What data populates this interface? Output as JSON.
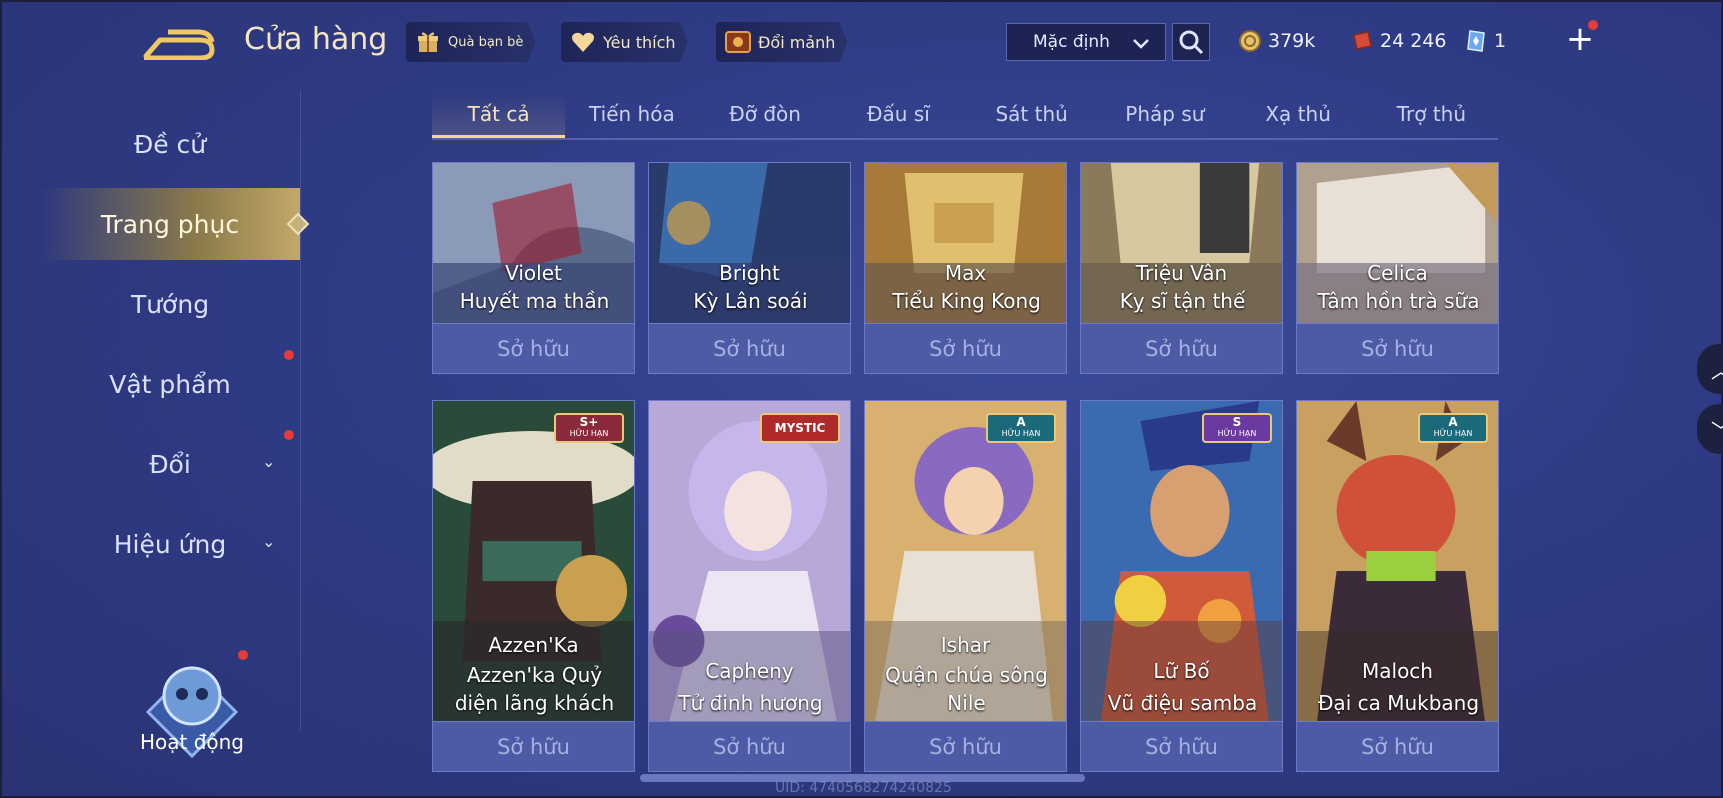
{
  "header": {
    "title": "Cửa hàng",
    "buttons": [
      {
        "label": "Quà bạn bè",
        "icon": "gift-icon"
      },
      {
        "label": "Yêu thích",
        "icon": "heart-icon"
      },
      {
        "label": "Đổi mảnh",
        "icon": "shard-chest-icon"
      }
    ],
    "sort_value": "Mặc định",
    "currencies": [
      {
        "value": "379k",
        "icon": "gold-coin-icon"
      },
      {
        "value": "24 246",
        "icon": "red-voucher-icon"
      },
      {
        "value": "1",
        "icon": "diamond-card-icon"
      }
    ]
  },
  "nav": {
    "items": [
      {
        "label": "Đề cử",
        "active": false
      },
      {
        "label": "Trang phục",
        "active": true
      },
      {
        "label": "Tướng",
        "active": false
      },
      {
        "label": "Vật phẩm",
        "active": false
      },
      {
        "label": "Đổi",
        "active": false
      },
      {
        "label": "Hiệu ứng",
        "active": false
      }
    ],
    "activity_label": "Hoạt động"
  },
  "tabs": [
    "Tất cả",
    "Tiến hóa",
    "Đỡ đòn",
    "Đấu sĩ",
    "Sát thủ",
    "Pháp sư",
    "Xạ thủ",
    "Trợ thủ"
  ],
  "cards_row1": [
    {
      "hero": "Violet",
      "skin": "Huyết ma thần",
      "status": "Sở hữu"
    },
    {
      "hero": "Bright",
      "skin": "Kỳ Lân soái",
      "status": "Sở hữu"
    },
    {
      "hero": "Max",
      "skin": "Tiểu King Kong",
      "status": "Sở hữu"
    },
    {
      "hero": "Triệu Vân",
      "skin": "Kỵ sĩ tận thế",
      "status": "Sở hữu"
    },
    {
      "hero": "Celica",
      "skin": "Tâm hồn trà sữa",
      "status": "Sở hữu"
    }
  ],
  "cards_row2": [
    {
      "hero": "Azzen'Ka",
      "skin1": "Azzen'ka Quỷ",
      "skin2": "diện lãng khách",
      "status": "Sở hữu",
      "badge_top": "S+",
      "badge_bottom": "HỮU HẠN"
    },
    {
      "hero": "Capheny",
      "skin1": "Tử đinh hương",
      "skin2": "",
      "status": "Sở hữu",
      "badge_top": "MYSTIC",
      "badge_bottom": ""
    },
    {
      "hero": "Ishar",
      "skin1": "Quận chúa sông",
      "skin2": "Nile",
      "status": "Sở hữu",
      "badge_top": "A",
      "badge_bottom": "HỮU HẠN"
    },
    {
      "hero": "Lữ Bố",
      "skin1": "Vũ điệu samba",
      "skin2": "",
      "status": "Sở hữu",
      "badge_top": "S",
      "badge_bottom": "HỮU HẠN"
    },
    {
      "hero": "Maloch",
      "skin1": "Đại ca Mukbang",
      "skin2": "",
      "status": "Sở hữu",
      "badge_top": "A",
      "badge_bottom": "HỮU HẠN"
    }
  ],
  "uid": "UID: 4740568274240825"
}
